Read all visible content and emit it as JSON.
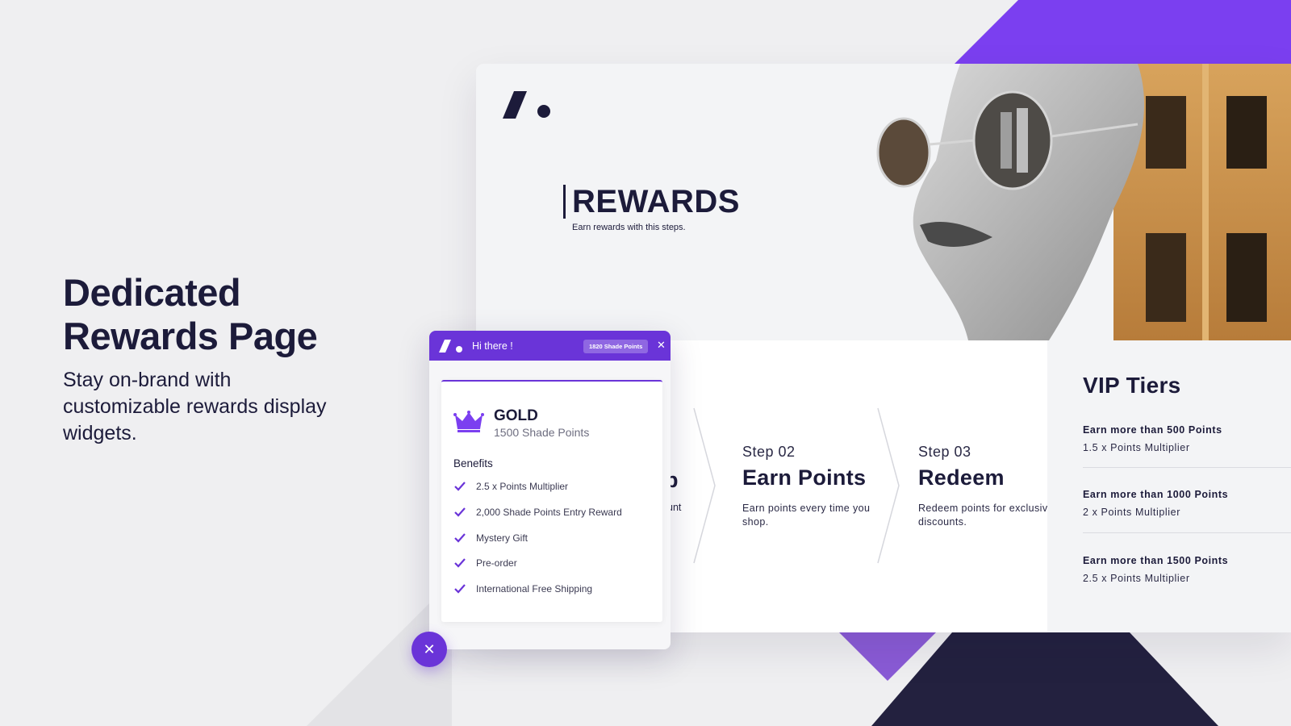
{
  "marketing": {
    "headline_line1": "Dedicated",
    "headline_line2": "Rewards Page",
    "subline": "Stay on-brand with customizable rewards display widgets."
  },
  "rewards_page": {
    "title": "REWARDS",
    "subtitle": "Earn rewards with this steps.",
    "steps": [
      {
        "number": "Step 02",
        "title": "Earn Points",
        "description": "Earn points every time you shop."
      },
      {
        "number": "Step 03",
        "title": "Redeem",
        "description": "Redeem points for exclusive discounts."
      }
    ],
    "step1_fragments": {
      "title": "p",
      "desc": "unt"
    },
    "vip": {
      "title": "VIP Tiers",
      "tiers": [
        {
          "name": "Earn more than 500  Points",
          "multiplier": "1.5 x Points Multiplier"
        },
        {
          "name": "Earn more than 1000  Points",
          "multiplier": "2 x Points Multiplier"
        },
        {
          "name": "Earn more than 1500  Points",
          "multiplier": "2.5 x Points Multiplier"
        }
      ]
    }
  },
  "widget": {
    "greeting": "Hi there !",
    "points_badge": "1820 Shade Points",
    "close_icon": "close-icon",
    "tier": {
      "name": "GOLD",
      "points": "1500 Shade Points",
      "icon": "crown-icon"
    },
    "benefits_heading": "Benefits",
    "benefits": [
      "2.5 x Points Multiplier",
      "2,000 Shade Points Entry Reward",
      "Mystery Gift",
      "Pre-order",
      "International Free Shipping"
    ],
    "fab_icon": "close-icon"
  },
  "colors": {
    "accent": "#6a34d8",
    "dark": "#1c1b3a",
    "background": "#efeff1"
  }
}
